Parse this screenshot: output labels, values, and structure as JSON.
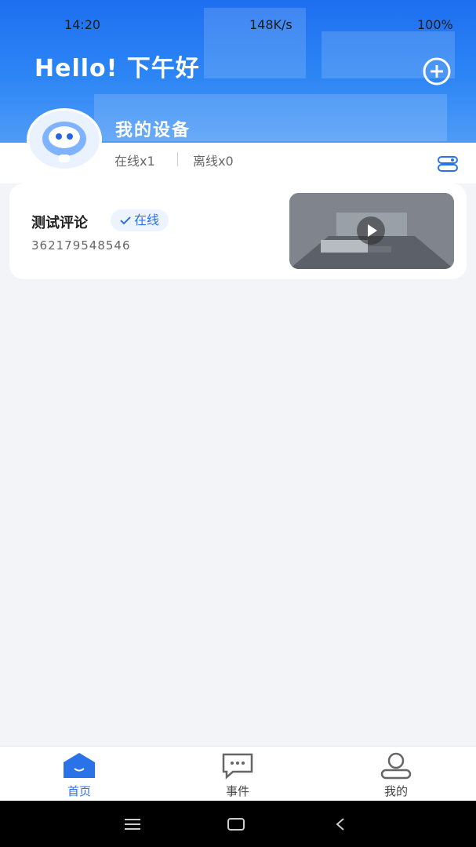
{
  "status_bar": {
    "time": "14:20",
    "network": "148K/s",
    "battery": "100%"
  },
  "header": {
    "greeting": "Hello! 下午好"
  },
  "devices": {
    "title": "我的设备",
    "online": "在线x1",
    "offline": "离线x0"
  },
  "card": {
    "name": "测试评论",
    "status": "在线",
    "id": "362179548546"
  },
  "nav": {
    "items": [
      {
        "label": "首页"
      },
      {
        "label": "事件"
      },
      {
        "label": "我的"
      }
    ]
  },
  "colors": {
    "accent": "#1e6ff0",
    "bg": "#f3f4f8",
    "active": "#2a72e8"
  }
}
